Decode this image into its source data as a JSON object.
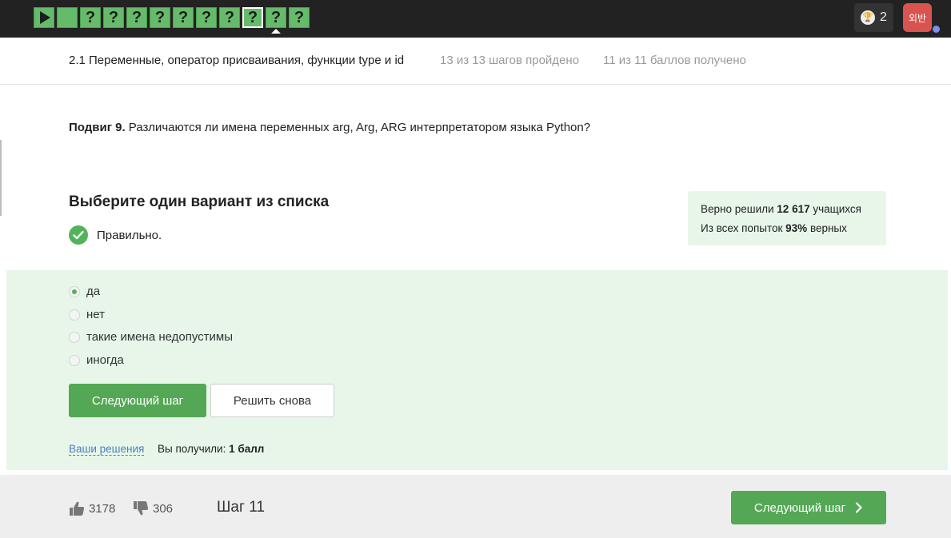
{
  "steps": [
    {
      "type": "play",
      "label": ""
    },
    {
      "type": "blank",
      "label": ""
    },
    {
      "type": "quiz",
      "label": "?"
    },
    {
      "type": "quiz",
      "label": "?"
    },
    {
      "type": "quiz",
      "label": "?"
    },
    {
      "type": "quiz",
      "label": "?"
    },
    {
      "type": "quiz",
      "label": "?"
    },
    {
      "type": "quiz",
      "label": "?"
    },
    {
      "type": "quiz",
      "label": "?"
    },
    {
      "type": "quiz",
      "label": "?",
      "active": true
    },
    {
      "type": "quiz",
      "label": "?"
    },
    {
      "type": "quiz",
      "label": "?"
    }
  ],
  "topbar": {
    "award_count": "2",
    "avatar_text": "외반"
  },
  "header": {
    "lesson_title": "2.1 Переменные, оператор присваивания, функции type и id",
    "steps_progress": "13 из 13 шагов пройдено",
    "points_progress": "11 из 11 баллов  получено"
  },
  "question": {
    "label": "Подвиг 9.",
    "text": " Различаются ли имена переменных arg, Arg, ARG интерпретатором языка Python?"
  },
  "answer": {
    "instruction": "Выберите один вариант из списка",
    "status": "Правильно.",
    "options": [
      {
        "label": "да",
        "selected": true
      },
      {
        "label": "нет",
        "selected": false
      },
      {
        "label": "такие имена недопустимы",
        "selected": false
      },
      {
        "label": "иногда",
        "selected": false
      }
    ]
  },
  "stats": {
    "line1_prefix": "Верно решили ",
    "line1_value": "12 617",
    "line1_suffix": " учащихся",
    "line2_prefix": "Из всех попыток ",
    "line2_value": "93%",
    "line2_suffix": " верных"
  },
  "buttons": {
    "next_step": "Следующий шаг",
    "retry": "Решить снова"
  },
  "solutions": {
    "link": "Ваши решения",
    "score_prefix": "Вы получили: ",
    "score_value": "1 балл"
  },
  "footer": {
    "likes": "3178",
    "dislikes": "306",
    "step_label": "Шаг 11",
    "next_button": "Следующий шаг"
  },
  "colors": {
    "accent_green": "#54a855",
    "panel_green": "#e7f6e8",
    "topbar": "#222222",
    "link_blue": "#4a7fc1"
  }
}
